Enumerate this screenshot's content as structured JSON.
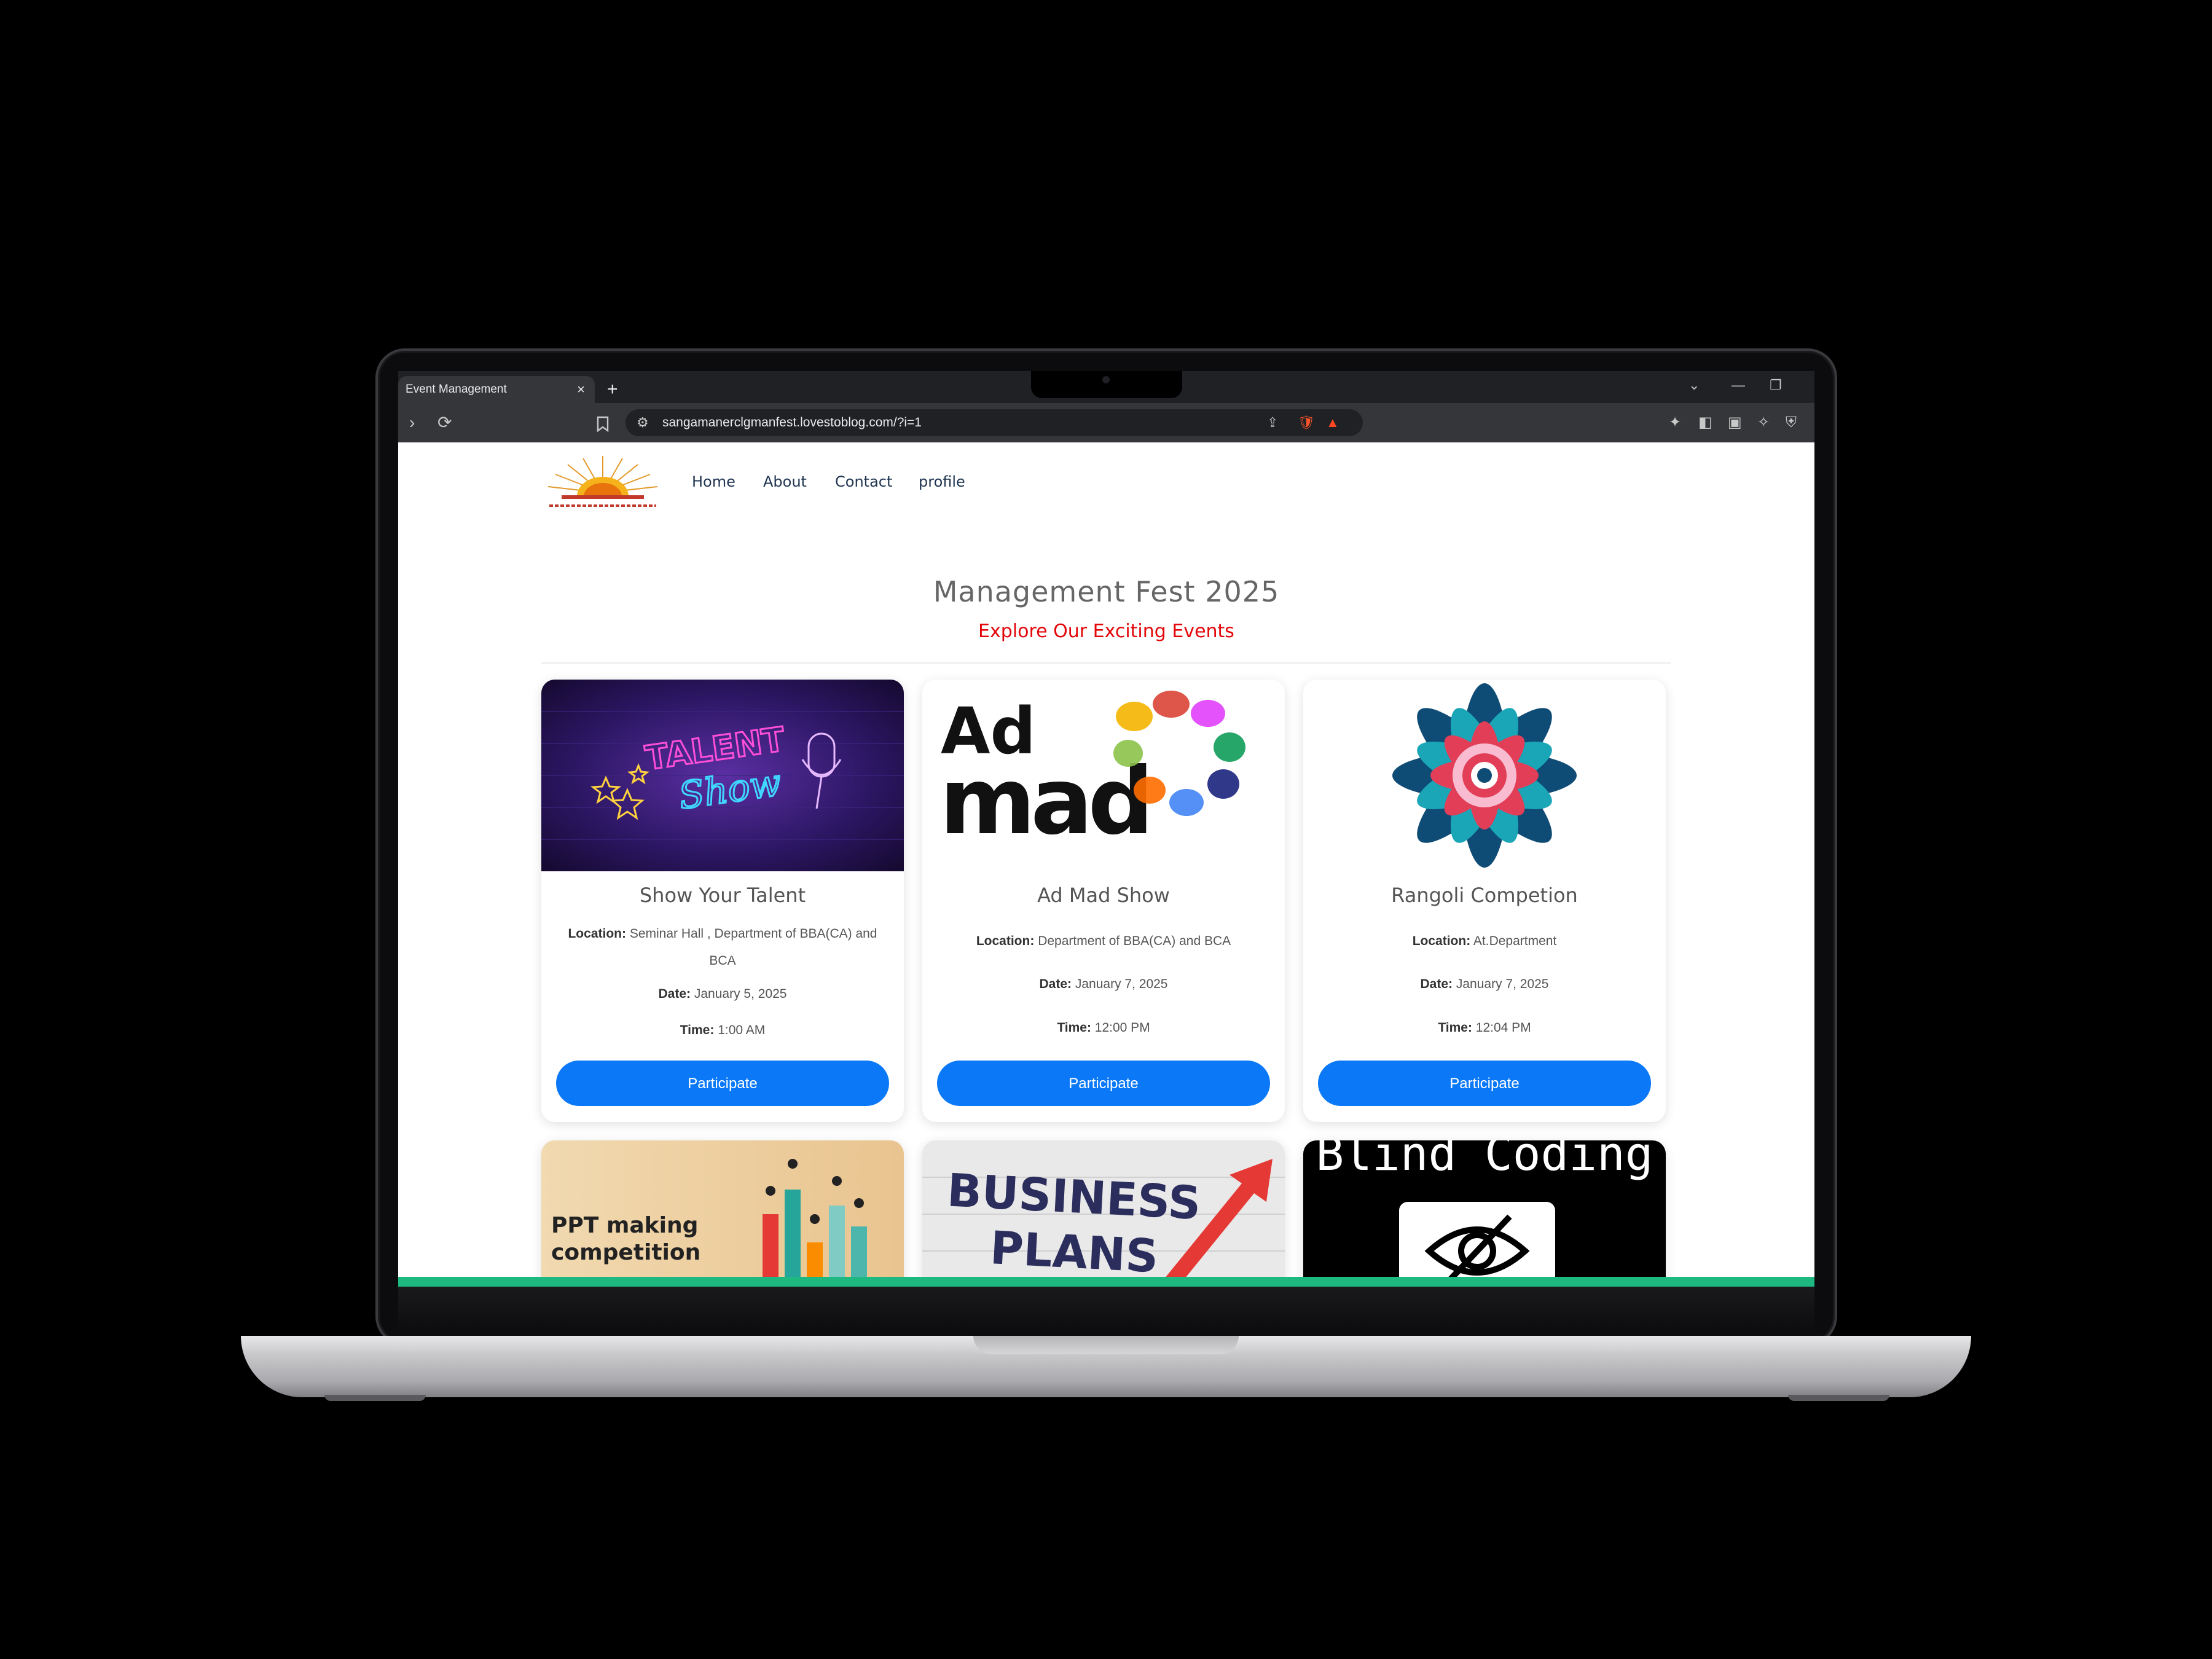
{
  "browser": {
    "tab_title": "Event Management",
    "tab_close": "×",
    "new_tab": "+",
    "url": "sangamanerclgmanfest.lovestoblog.com/?i=1"
  },
  "nav": {
    "links": [
      "Home",
      "About",
      "Contact",
      "profile"
    ]
  },
  "hero": {
    "title": "Management Fest 2025",
    "subtitle": "Explore Our Exciting Events"
  },
  "labels": {
    "location": "Location:",
    "date": "Date:",
    "time": "Time:"
  },
  "events": [
    {
      "title": "Show Your Talent",
      "location": "Seminar Hall , Department of BBA(CA) and BCA",
      "date": "January 5, 2025",
      "time": "1:00 AM",
      "button": "Participate",
      "image_text": [
        "TALENT",
        "Show"
      ]
    },
    {
      "title": "Ad Mad Show",
      "location": "Department of BBA(CA) and BCA",
      "date": "January 7, 2025",
      "time": "12:00 PM",
      "button": "Participate",
      "image_text": [
        "Ad",
        "mad"
      ]
    },
    {
      "title": "Rangoli Competion",
      "location": "At.Department",
      "date": "January 7, 2025",
      "time": "12:04 PM",
      "button": "Participate"
    }
  ],
  "more_events": [
    {
      "image_text": [
        "PPT making",
        "competition"
      ]
    },
    {
      "image_text": [
        "BUSINESS",
        "PLANS"
      ]
    },
    {
      "image_text": [
        "Blind  Coding"
      ]
    }
  ],
  "colors": {
    "accent": "#0b79f7",
    "subtitle": "#e3070a",
    "footer_bar": "#1eb980"
  }
}
